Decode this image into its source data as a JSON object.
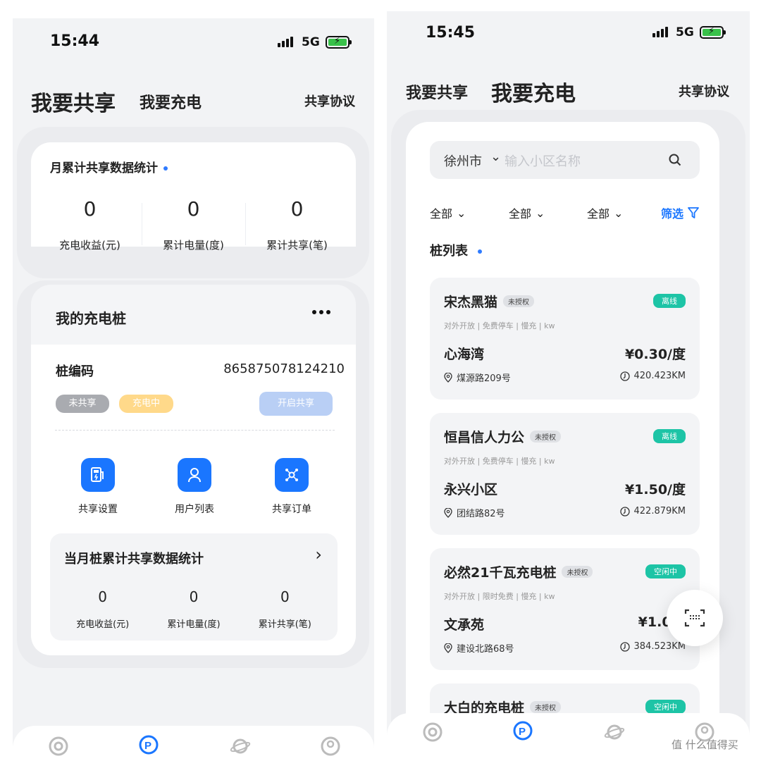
{
  "left": {
    "status": {
      "time": "15:44",
      "network": "5G"
    },
    "tabs": {
      "share": "我要共享",
      "charge": "我要充电",
      "agreement": "共享协议"
    },
    "monthly": {
      "title": "月累计共享数据统计",
      "stats": [
        {
          "value": "0",
          "label": "充电收益(元)"
        },
        {
          "value": "0",
          "label": "累计电量(度)"
        },
        {
          "value": "0",
          "label": "累计共享(笔)"
        }
      ]
    },
    "my_piles": {
      "title": "我的充电桩",
      "more_icon": "more-dots-icon",
      "code_label": "桩编码",
      "code_value": "865875078124210",
      "tag_unshared": "未共享",
      "tag_charging": "充电中",
      "open_share": "开启共享",
      "actions": [
        {
          "label": "共享设置",
          "icon": "charger-settings-icon"
        },
        {
          "label": "用户列表",
          "icon": "user-icon"
        },
        {
          "label": "共享订单",
          "icon": "share-order-icon"
        }
      ],
      "sub_stats": {
        "title": "当月桩累计共享数据统计",
        "stats": [
          {
            "value": "0",
            "label": "充电收益(元)"
          },
          {
            "value": "0",
            "label": "累计电量(度)"
          },
          {
            "value": "0",
            "label": "累计共享(笔)"
          }
        ]
      }
    }
  },
  "right": {
    "status": {
      "time": "15:45",
      "network": "5G"
    },
    "tabs": {
      "share": "我要共享",
      "charge": "我要充电",
      "agreement": "共享协议"
    },
    "search": {
      "city": "徐州市",
      "placeholder": "输入小区名称"
    },
    "filters": [
      {
        "label": "全部"
      },
      {
        "label": "全部"
      },
      {
        "label": "全部"
      }
    ],
    "filter_button": "筛选",
    "list_title": "桩列表",
    "piles": [
      {
        "name": "宋杰黑猫",
        "auth": "未授权",
        "state": "离线",
        "meta": "对外开放 | 免费停车 | 慢充 | kw",
        "place": "心海湾",
        "price": "¥0.30/度",
        "addr": "煤源路209号",
        "dist": "420.423KM"
      },
      {
        "name": "恒昌信人力公",
        "auth": "未授权",
        "state": "离线",
        "meta": "对外开放 | 免费停车 | 慢充 | kw",
        "place": "永兴小区",
        "price": "¥1.50/度",
        "addr": "团结路82号",
        "dist": "422.879KM"
      },
      {
        "name": "必然21千瓦充电桩",
        "auth": "未授权",
        "state": "空闲中",
        "meta": "对外开放 | 限时免费 | 慢充 | kw",
        "place": "文承苑",
        "price": "¥1.00,",
        "addr": "建设北路68号",
        "dist": "384.523KM"
      },
      {
        "name": "大白的充电桩",
        "auth": "未授权",
        "state": "空闲中"
      }
    ],
    "watermark": "值 什么值得买"
  },
  "colors": {
    "accent": "#1a76ff",
    "teal": "#1dc4a6",
    "gray_tag": "#a9abb0",
    "yellow_tag": "#ffd98a",
    "light_blue_btn": "#b9cff5"
  }
}
